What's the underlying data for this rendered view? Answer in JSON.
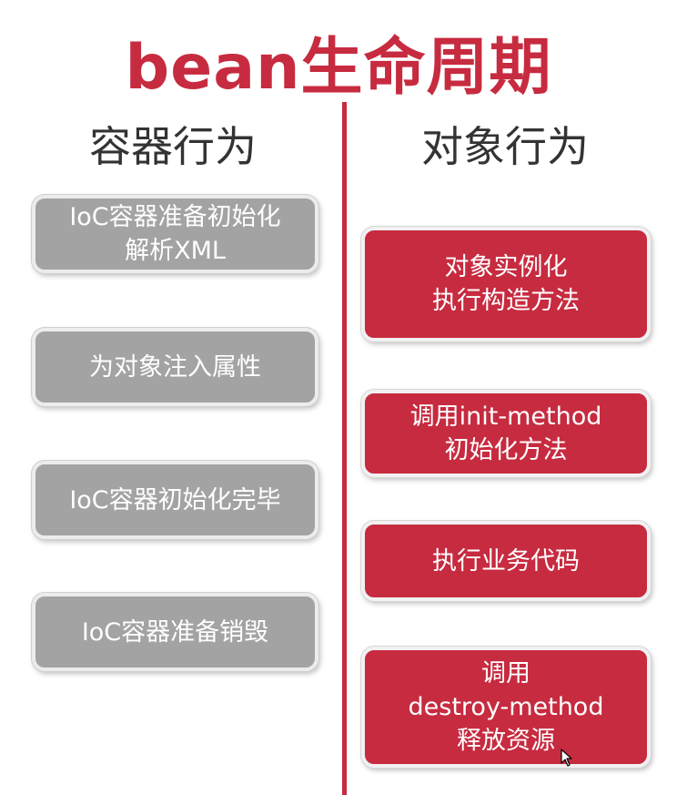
{
  "title": "bean生命周期",
  "columns": {
    "left": {
      "header": "容器行为",
      "items": [
        "IoC容器准备初始化\n解析XML",
        "为对象注入属性",
        "IoC容器初始化完毕",
        "IoC容器准备销毁"
      ]
    },
    "right": {
      "header": "对象行为",
      "items": [
        "对象实例化\n执行构造方法",
        "调用init-method\n初始化方法",
        "执行业务代码",
        "调用\ndestroy-method\n释放资源"
      ]
    }
  },
  "colors": {
    "accent": "#c72b40",
    "container_box": "#a3a3a3",
    "header_text": "#333333"
  }
}
